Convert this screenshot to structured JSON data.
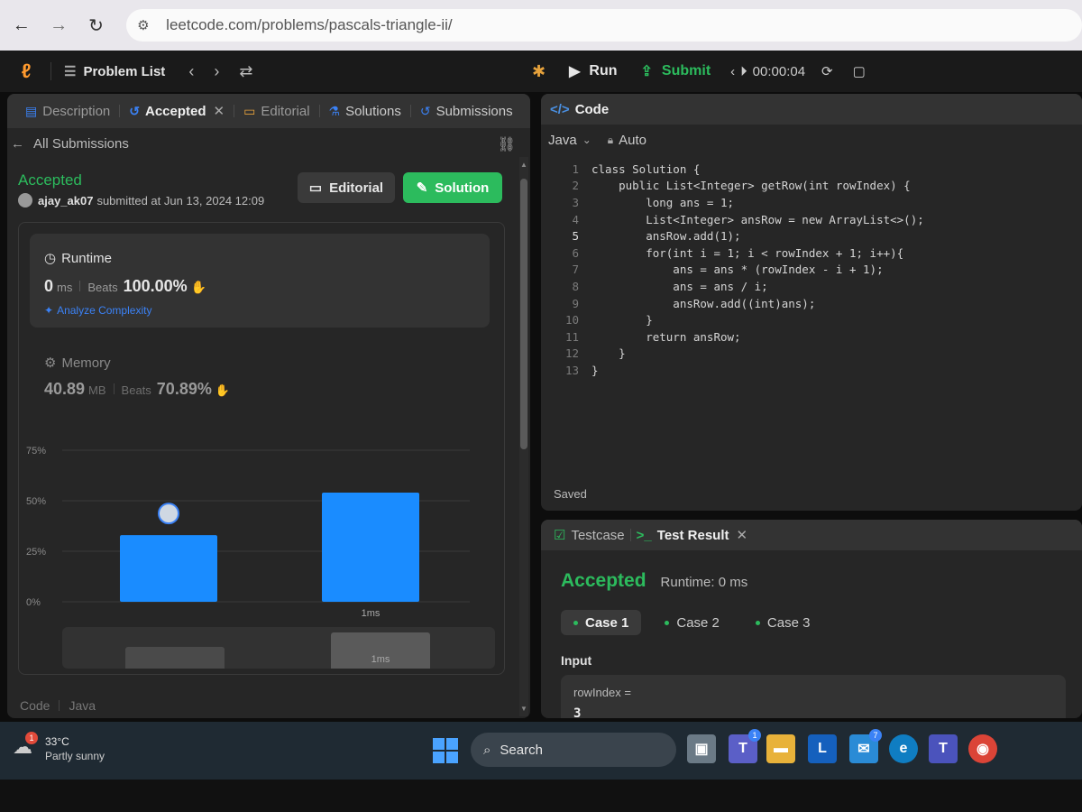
{
  "browser": {
    "url": "leetcode.com/problems/pascals-triangle-ii/"
  },
  "topbar": {
    "problem_list": "Problem List",
    "run": "Run",
    "submit": "Submit",
    "timer": "00:00:04"
  },
  "left_tabs": [
    {
      "label": "Description"
    },
    {
      "label": "Accepted"
    },
    {
      "label": "Editorial"
    },
    {
      "label": "Solutions"
    },
    {
      "label": "Submissions"
    }
  ],
  "submission": {
    "back_label": "All Submissions",
    "status": "Accepted",
    "user": "ajay_ak07",
    "submitted_text": "submitted at Jun 13, 2024 12:09",
    "editorial_btn": "Editorial",
    "solution_btn": "Solution"
  },
  "runtime": {
    "title": "Runtime",
    "value": "0",
    "unit": "ms",
    "beats_label": "Beats",
    "beats_pct": "100.00%",
    "analyze": "Analyze Complexity"
  },
  "memory": {
    "title": "Memory",
    "value": "40.89",
    "unit": "MB",
    "beats_label": "Beats",
    "beats_pct": "70.89%"
  },
  "chart_data": {
    "type": "bar",
    "categories": [
      "",
      "1ms"
    ],
    "values": [
      33,
      54
    ],
    "ylim": [
      0,
      75
    ],
    "yticks": [
      "0%",
      "25%",
      "50%",
      "75%"
    ],
    "grid": true,
    "color": "#1a8cff",
    "mini_label": "1ms"
  },
  "left_footer": {
    "code_label": "Code",
    "lang": "Java"
  },
  "code_panel": {
    "tab": "Code",
    "language": "Java",
    "mode": "Auto",
    "saved": "Saved",
    "lines": [
      "class Solution {",
      "    public List<Integer> getRow(int rowIndex) {",
      "        long ans = 1;",
      "        List<Integer> ansRow = new ArrayList<>();",
      "        ansRow.add(1);",
      "        for(int i = 1; i < rowIndex + 1; i++){",
      "            ans = ans * (rowIndex - i + 1);",
      "            ans = ans / i;",
      "            ansRow.add((int)ans);",
      "        }",
      "        return ansRow;",
      "    }",
      "}"
    ],
    "line_numbers": [
      "1",
      "2",
      "3",
      "4",
      "5",
      "6",
      "7",
      "8",
      "9",
      "10",
      "11",
      "12",
      "13"
    ]
  },
  "test_panel": {
    "testcase_tab": "Testcase",
    "result_tab": "Test Result",
    "status": "Accepted",
    "runtime": "Runtime: 0 ms",
    "cases": [
      "Case 1",
      "Case 2",
      "Case 3"
    ],
    "input_label": "Input",
    "input_name": "rowIndex =",
    "input_value": "3"
  },
  "taskbar": {
    "temperature": "33°C",
    "condition": "Partly sunny",
    "weather_badge": "1",
    "search": "Search",
    "teams_badge": "1",
    "mail_badge": "7"
  }
}
